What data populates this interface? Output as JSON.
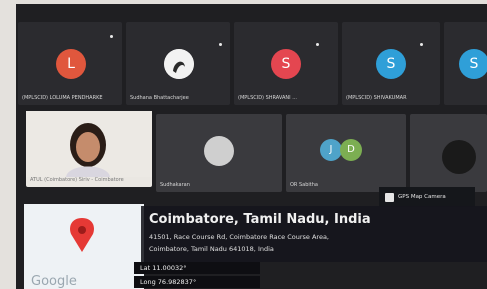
{
  "participants_top": [
    {
      "initial": "L",
      "color": "#e0573d",
      "name": "(MPLSCID) LOLUMA PENDHARKE"
    },
    {
      "initial": "",
      "color": "#f2f2f2",
      "name": "Sudhana Bhattacharjee"
    },
    {
      "initial": "S",
      "color": "#e44650",
      "name": "(MPLSCID) SHRAVANI ..."
    },
    {
      "initial": "S",
      "color": "#2f9fd8",
      "name": "(MPLSCID) SHIVAKUMAR"
    },
    {
      "initial": "S",
      "color": "#2f9fd8",
      "name": ""
    }
  ],
  "participants_mid": [
    {
      "name": "ATUL (Coimbatore) Siriv - Coimbatore"
    },
    {
      "name": "Sudhakaran"
    },
    {
      "initials": [
        "J",
        "D"
      ],
      "name": "OR Sabitha"
    },
    {
      "name": ""
    }
  ],
  "gps_button": {
    "label": "GPS Map Camera"
  },
  "location": {
    "city": "Coimbatore, Tamil Nadu, India",
    "address_line1": "41501, Race Course Rd, Coimbatore Race Course Area,",
    "address_line2": "Coimbatore, Tamil Nadu 641018, India",
    "lat": "Lat 11.00032°",
    "long": "Long 76.982837°"
  },
  "map": {
    "brand": "Google"
  }
}
